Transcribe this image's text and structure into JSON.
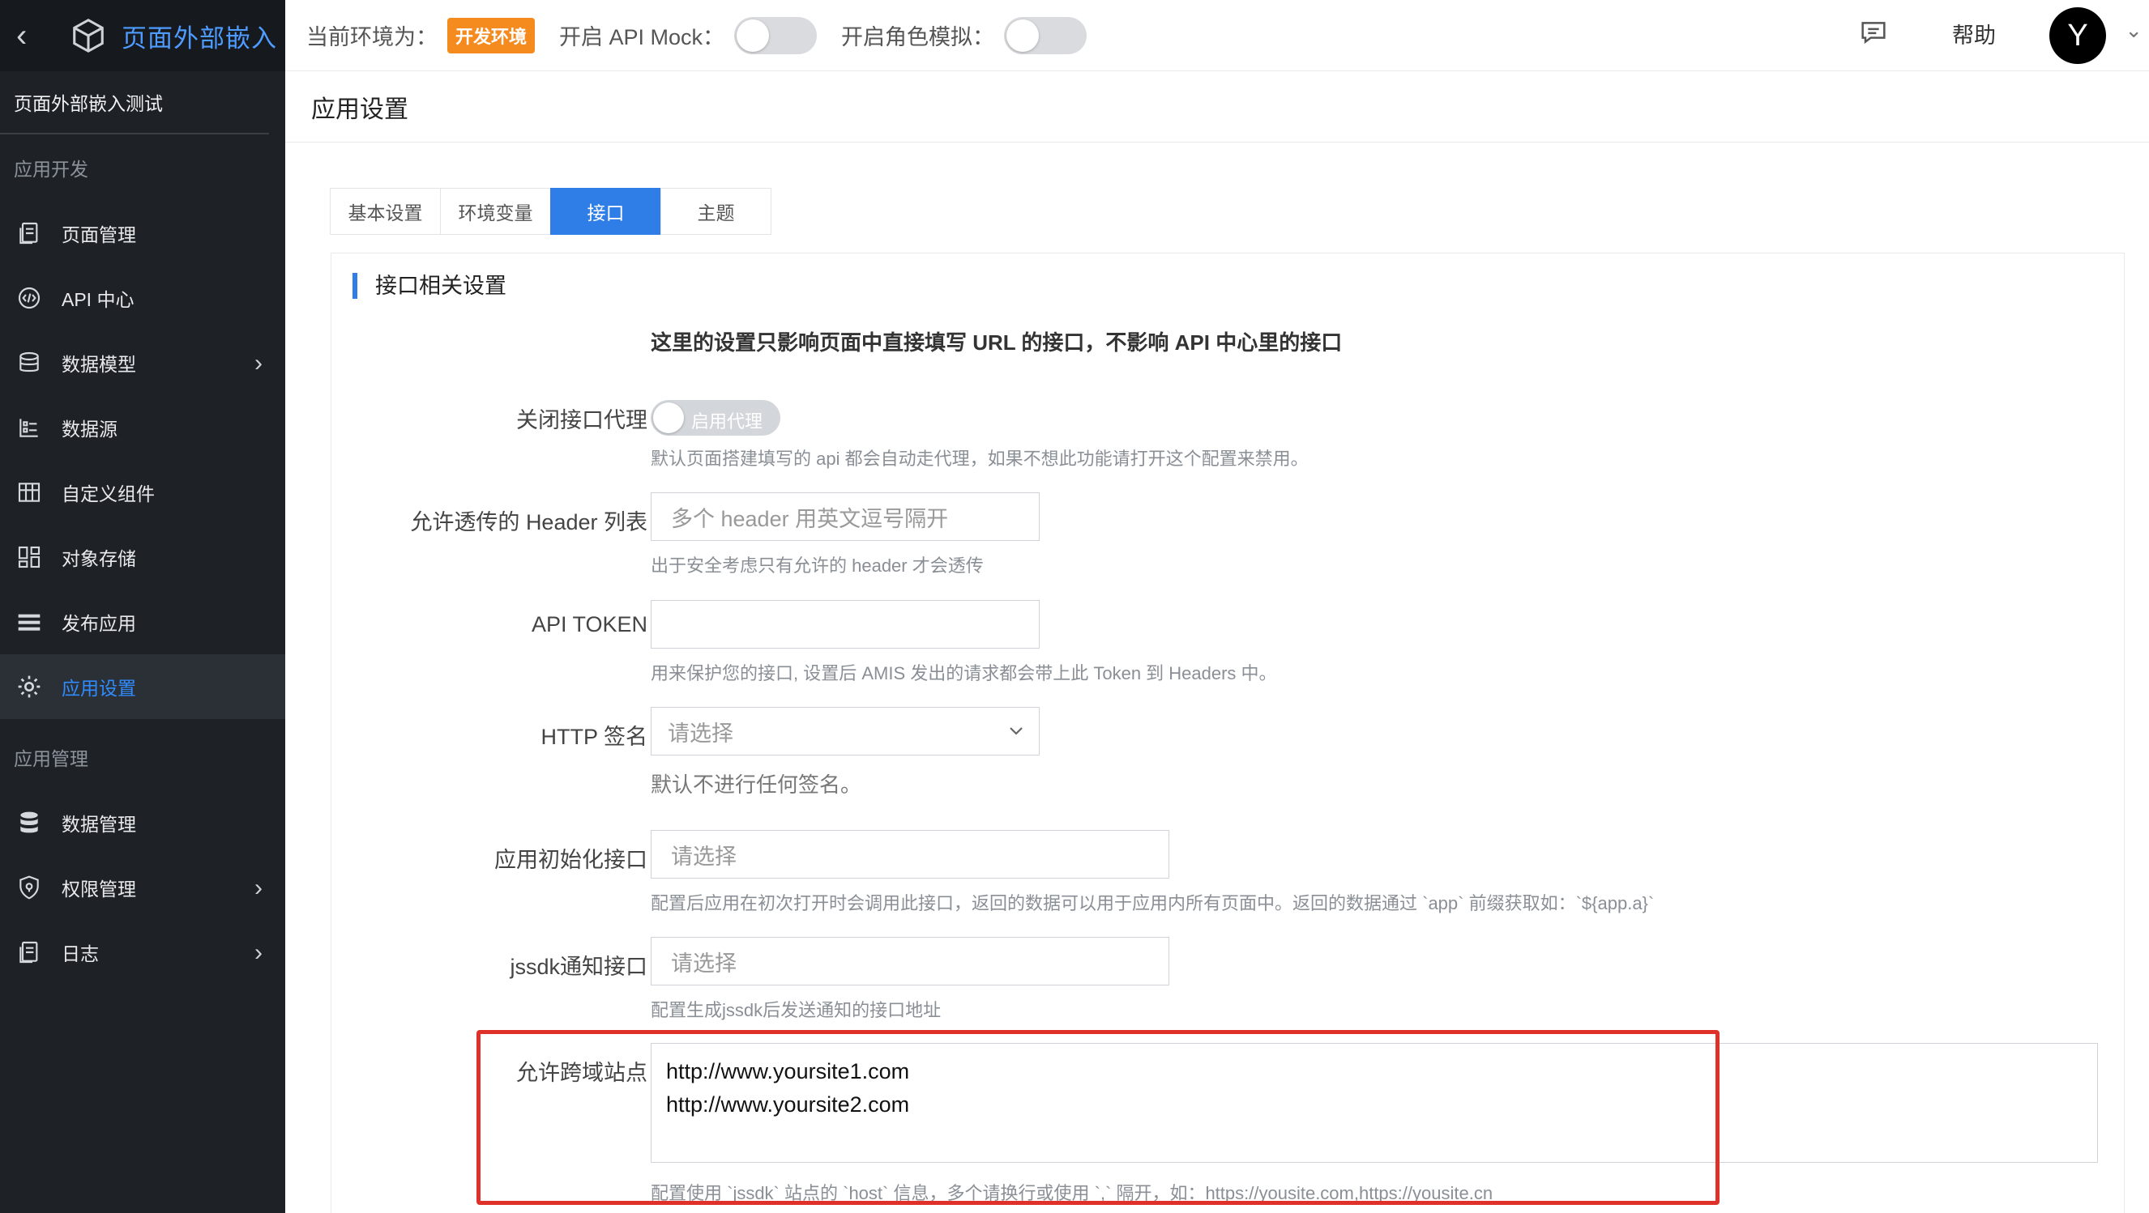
{
  "sidebar": {
    "brand_title": "页面外部嵌入",
    "app_name": "页面外部嵌入测试",
    "section_dev": "应用开发",
    "section_manage": "应用管理",
    "items": [
      {
        "label": "页面管理"
      },
      {
        "label": "API 中心"
      },
      {
        "label": "数据模型"
      },
      {
        "label": "数据源"
      },
      {
        "label": "自定义组件"
      },
      {
        "label": "对象存储"
      },
      {
        "label": "发布应用"
      },
      {
        "label": "应用设置"
      },
      {
        "label": "数据管理"
      },
      {
        "label": "权限管理"
      },
      {
        "label": "日志"
      }
    ],
    "active_color": "#2f8cff"
  },
  "topbar": {
    "env_label": "当前环境为：",
    "env_badge": "开发环境",
    "mock_label": "开启 API Mock：",
    "role_label": "开启角色模拟：",
    "help": "帮助",
    "avatar_letter": "Y"
  },
  "page": {
    "title": "应用设置",
    "tabs": [
      {
        "label": "基本设置"
      },
      {
        "label": "环境变量"
      },
      {
        "label": "接口"
      },
      {
        "label": "主题"
      }
    ],
    "active_tab": "接口",
    "panel_title": "接口相关设置",
    "notice": "这里的设置只影响页面中直接填写 URL 的接口，不影响 API 中心里的接口"
  },
  "form": {
    "proxy": {
      "label": "关闭接口代理",
      "switch_text": "启用代理",
      "help": "默认页面搭建填写的 api 都会自动走代理，如果不想此功能请打开这个配置来禁用。"
    },
    "headers": {
      "label": "允许透传的 Header 列表",
      "placeholder": "多个 header 用英文逗号隔开",
      "help": "出于安全考虑只有允许的 header 才会透传"
    },
    "token": {
      "label": "API TOKEN",
      "value": "",
      "help": "用来保护您的接口, 设置后 AMIS 发出的请求都会带上此 Token 到 Headers 中。"
    },
    "signature": {
      "label": "HTTP 签名",
      "placeholder": "请选择",
      "help": "默认不进行任何签名。"
    },
    "init_api": {
      "label": "应用初始化接口",
      "placeholder": "请选择",
      "help": "配置后应用在初次打开时会调用此接口，返回的数据可以用于应用内所有页面中。返回的数据通过 `app` 前缀获取如：`${app.a}`"
    },
    "jssdk_api": {
      "label": "jssdk通知接口",
      "placeholder": "请选择",
      "help": "配置生成jssdk后发送通知的接口地址"
    },
    "cors": {
      "label": "允许跨域站点",
      "line1": "http://www.yoursite1.com",
      "line2": "http://www.yoursite2.com",
      "help": "配置使用 `jssdk` 站点的 `host` 信息，多个请换行或使用 `,` 隔开，如：https://yousite.com,https://yousite.cn"
    }
  },
  "colors": {
    "accent": "#2f7ee8",
    "badge": "#f58a1f",
    "highlight": "#e0302a"
  }
}
